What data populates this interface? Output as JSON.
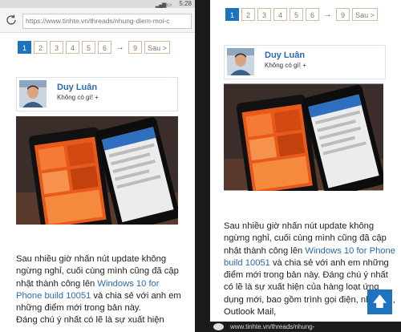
{
  "status": {
    "time": "5:28",
    "signal": "▂▄▆ ▭"
  },
  "browser": {
    "url": "https://www.tinhte.vn/threads/nhung-diem-moi-c",
    "url_bottom": "www.tinhte.vn/threads/nhung-"
  },
  "pagination": {
    "pages": [
      "1",
      "2",
      "3",
      "4",
      "5",
      "6"
    ],
    "arrow": "→",
    "last": "9",
    "next_label": "Sau >"
  },
  "author": {
    "name": "Duy Luân",
    "title": "Không có gì! +"
  },
  "article_left": {
    "p1": "Sau nhiều giờ nhấn nút update không ngừng nghỉ, cuối cùng mình cũng đã cập nhật thành công lên ",
    "link": "Windows 10 for Phone build 10051",
    "p2": " và chia sẻ với anh em những điểm mới trong bản này.",
    "p3": "Đáng chú ý nhất có lẽ là sự xuất hiện"
  },
  "article_right": {
    "p1": "Sau nhiều giờ nhấn nút update không ngừng nghỉ, cuối cùng mình cũng đã cập nhật thành công lên ",
    "link": "Windows 10 for Phone build 10051",
    "p2": " và chia sẻ với anh em những điểm mới trong bản này. Đáng chú ý nhất có lẽ là sự xuất hiện của hàng loạt ứng dụng mới, bao gồm trình gọi điện, nhắn tin, Outlook Mail,"
  },
  "scroll_top_icon": "arrow-up-icon",
  "colors": {
    "accent": "#1e73be",
    "link": "#2a6ab0",
    "pager_border": "#d6b9a2"
  }
}
